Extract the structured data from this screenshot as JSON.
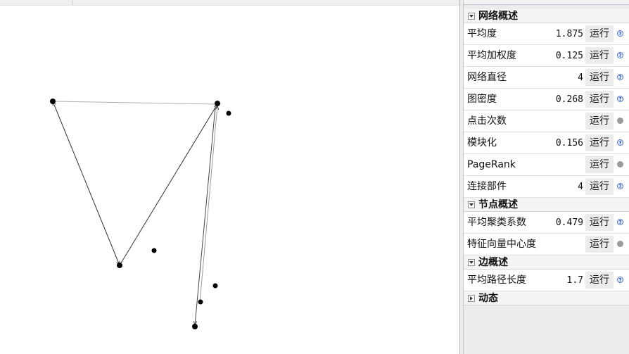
{
  "sections": [
    {
      "title": "网络概述",
      "expanded": true,
      "rows": [
        {
          "label": "平均度",
          "value": "1.875",
          "run": "运行",
          "help": "info"
        },
        {
          "label": "平均加权度",
          "value": "0.125",
          "run": "运行",
          "help": "info"
        },
        {
          "label": "网络直径",
          "value": "4",
          "run": "运行",
          "help": "info"
        },
        {
          "label": "图密度",
          "value": "0.268",
          "run": "运行",
          "help": "info"
        },
        {
          "label": "点击次数",
          "value": "",
          "run": "运行",
          "help": "disabled"
        },
        {
          "label": "模块化",
          "value": "0.156",
          "run": "运行",
          "help": "info"
        },
        {
          "label": "PageRank",
          "value": "",
          "run": "运行",
          "help": "disabled"
        },
        {
          "label": "连接部件",
          "value": "4",
          "run": "运行",
          "help": "info"
        }
      ]
    },
    {
      "title": "节点概述",
      "expanded": true,
      "rows": [
        {
          "label": "平均聚类系数",
          "value": "0.479",
          "run": "运行",
          "help": "info"
        },
        {
          "label": "特征向量中心度",
          "value": "",
          "run": "运行",
          "help": "disabled"
        }
      ]
    },
    {
      "title": "边概述",
      "expanded": true,
      "rows": [
        {
          "label": "平均路径长度",
          "value": "1.7",
          "run": "运行",
          "help": "info"
        }
      ]
    },
    {
      "title": "动态",
      "expanded": false,
      "rows": []
    }
  ],
  "help_glyph": "?",
  "colors": {
    "node": "#000000",
    "edge": "#3a3a3a",
    "edge_light": "#b0b0b0",
    "panel_bg": "#ececec",
    "help_blue": "#4d6fd0"
  }
}
